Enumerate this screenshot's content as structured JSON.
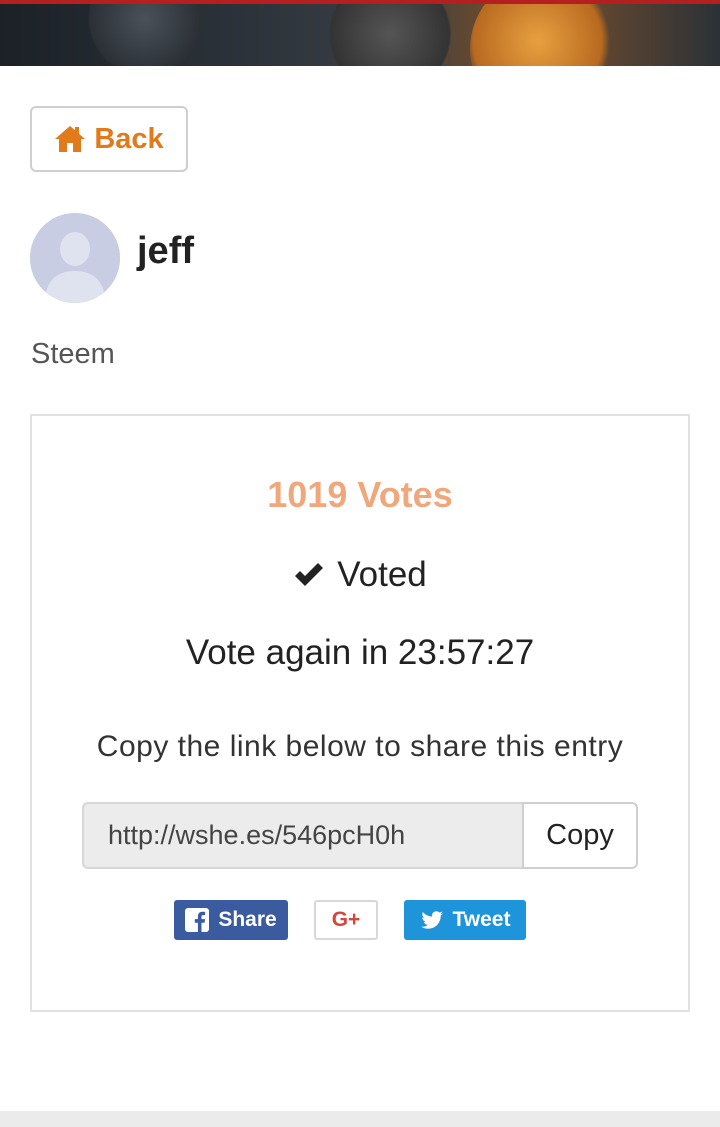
{
  "back_button": {
    "label": "Back",
    "icon": "home-icon",
    "color": "#e07a1a"
  },
  "profile": {
    "username": "jeff",
    "subtitle": "Steem"
  },
  "entry": {
    "votes_label": "1019 Votes",
    "voted_label": "Voted",
    "countdown_label": "Vote again in 23:57:27",
    "share_prompt": "Copy the link below to share this entry",
    "share_link": "http://wshe.es/546pcH0h",
    "copy_label": "Copy"
  },
  "social": {
    "facebook_label": "Share",
    "google_label": "G+",
    "twitter_label": "Tweet"
  },
  "colors": {
    "accent": "#e07a1a",
    "votes": "#f0a77c",
    "facebook": "#3b5ba0",
    "twitter": "#1e94db",
    "google": "#d9453a"
  }
}
